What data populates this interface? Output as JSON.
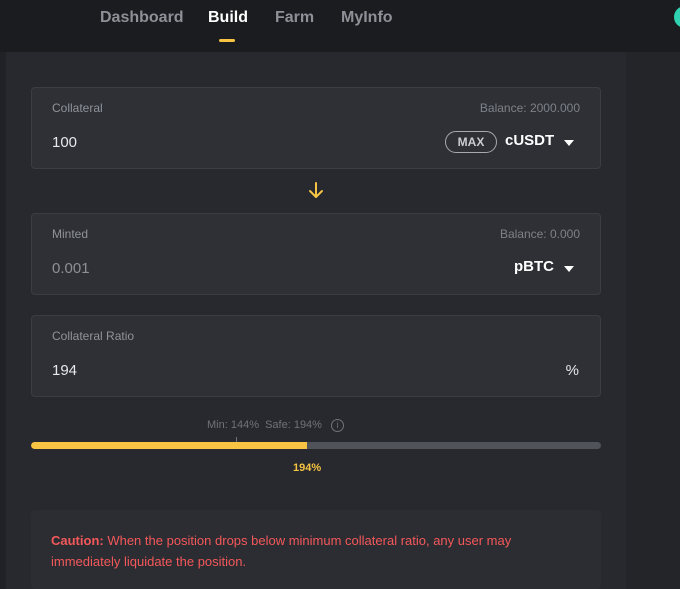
{
  "nav": {
    "items": [
      {
        "label": "Dashboard"
      },
      {
        "label": "Build"
      },
      {
        "label": "Farm"
      },
      {
        "label": "MyInfo"
      }
    ],
    "active": "Build",
    "accent": "#f6c343"
  },
  "collateral": {
    "label": "Collateral",
    "balance": "Balance: 2000.000",
    "value": "100",
    "max_label": "MAX",
    "token": "cUSDT"
  },
  "minted": {
    "label": "Minted",
    "balance": "Balance: 0.000",
    "value": "0.001",
    "token": "pBTC"
  },
  "ratio": {
    "label": "Collateral Ratio",
    "value": "194",
    "unit": "%",
    "meta": "Min: 144%  Safe: 194%",
    "info_icon": "i",
    "progress_label": "194%",
    "progress_fraction": 0.485
  },
  "caution": {
    "prefix": "Caution:",
    "text": " When the position drops below minimum collateral ratio, any user may immediately liquidate the position.",
    "color": "#f5585a"
  },
  "icons": {
    "arrow": "arrow-down-icon",
    "caret": "chevron-down-icon",
    "info": "info-icon"
  }
}
